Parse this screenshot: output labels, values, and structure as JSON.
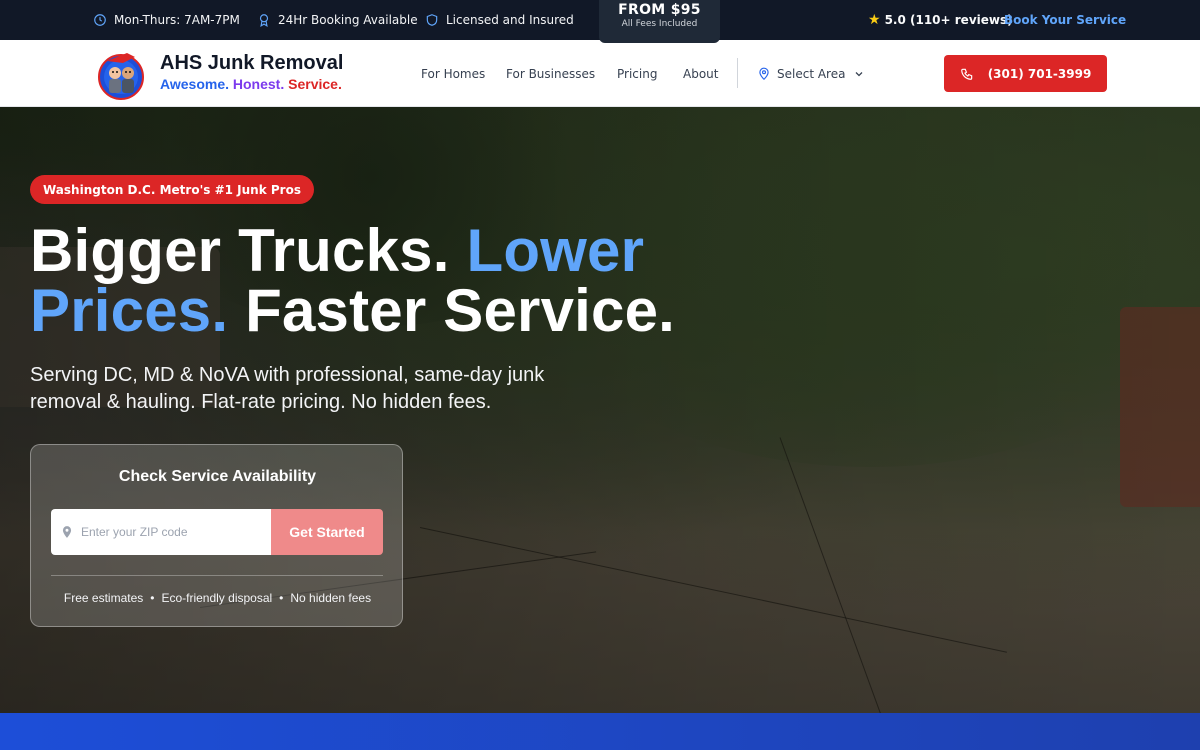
{
  "topbar": {
    "hours": "Mon-Thurs: 7AM-7PM",
    "booking": "24Hr Booking Available",
    "licensed": "Licensed and Insured",
    "from_price": "FROM $95",
    "from_sub": "All Fees Included",
    "rating": "5.0 (110+ reviews)",
    "book_link": "Book Your Service"
  },
  "nav": {
    "brand_name": "AHS Junk Removal",
    "tagline": {
      "awesome": "Awesome.",
      "honest": "Honest.",
      "service": "Service."
    },
    "links": [
      "For Homes",
      "For Businesses",
      "Pricing",
      "About"
    ],
    "area_select": "Select Area",
    "phone": "(301) 701-3999"
  },
  "hero": {
    "badge": "Washington D.C. Metro's #1 Junk Pros",
    "headline": {
      "part1": "Bigger Trucks. ",
      "accent": "Lower Prices.",
      "part2": " Faster Service."
    },
    "subheadline": "Serving DC, MD & NoVA with professional, same-day junk removal & hauling. Flat-rate pricing. No hidden fees.",
    "card": {
      "title": "Check Service Availability",
      "zip_placeholder": "Enter your ZIP code",
      "button": "Get Started",
      "features": [
        "Free estimates",
        "Eco-friendly disposal",
        "No hidden fees"
      ],
      "separator": "•"
    }
  },
  "colors": {
    "accent_blue": "#60a5fa",
    "brand_red": "#dc2626",
    "dark_bar": "#111827"
  },
  "icons": [
    "clock-icon",
    "award-icon",
    "shield-icon",
    "star-icon",
    "map-pin-icon",
    "chevron-down-icon",
    "phone-icon"
  ]
}
